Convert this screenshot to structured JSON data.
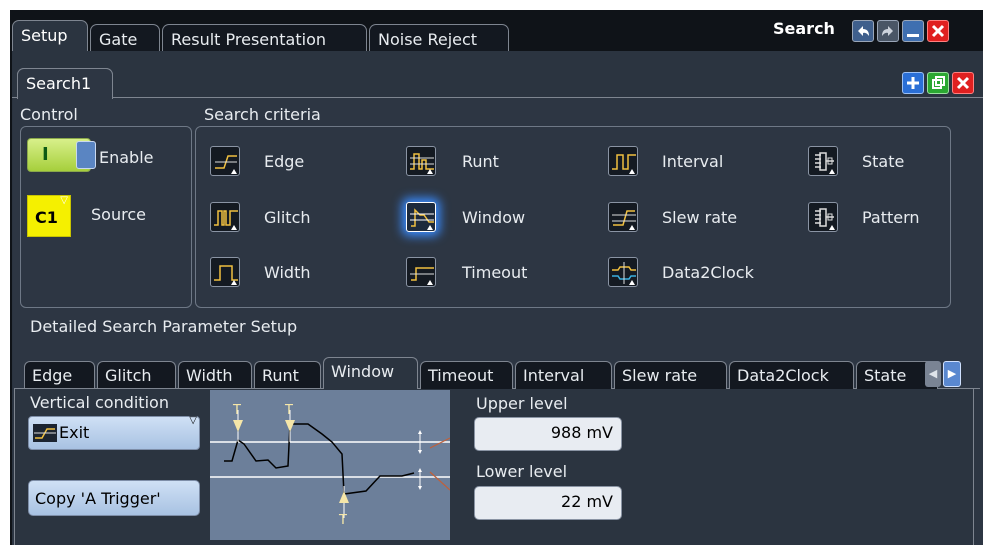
{
  "window": {
    "title": "Search",
    "tabs": [
      "Setup",
      "Gate",
      "Result Presentation",
      "Noise Reject"
    ],
    "active_tab": "Setup"
  },
  "search_tab": {
    "label": "Search1"
  },
  "control": {
    "heading": "Control",
    "enable_label": "Enable",
    "toggle_on_symbol": "I",
    "source_label": "Source",
    "source_value": "C1"
  },
  "criteria": {
    "heading": "Search criteria",
    "items": [
      "Edge",
      "Runt",
      "Interval",
      "State",
      "Glitch",
      "Window",
      "Slew rate",
      "Pattern",
      "Width",
      "Timeout",
      "Data2Clock"
    ],
    "selected": "Window"
  },
  "detail": {
    "heading": "Detailed Search Parameter Setup",
    "tabs": [
      "Edge",
      "Glitch",
      "Width",
      "Runt",
      "Window",
      "Timeout",
      "Interval",
      "Slew rate",
      "Data2Clock",
      "State"
    ],
    "active_tab": "Window",
    "vertical_condition_label": "Vertical condition",
    "vertical_condition_value": "Exit",
    "copy_button": "Copy 'A Trigger'",
    "marker_label": "T",
    "upper_level_label": "Upper level",
    "upper_level_value": "988 mV",
    "lower_level_label": "Lower level",
    "lower_level_value": "22 mV"
  },
  "colors": {
    "background": "#0f1318",
    "panel": "#2b3440",
    "signal_icon": "#f0c040",
    "selection_glow": "#3a8cff",
    "source_badge": "#f5f000",
    "enable_toggle": "#b6e04a",
    "close_red": "#e02020",
    "add_blue": "#2b6fd6",
    "copy_green": "#2ba832"
  }
}
